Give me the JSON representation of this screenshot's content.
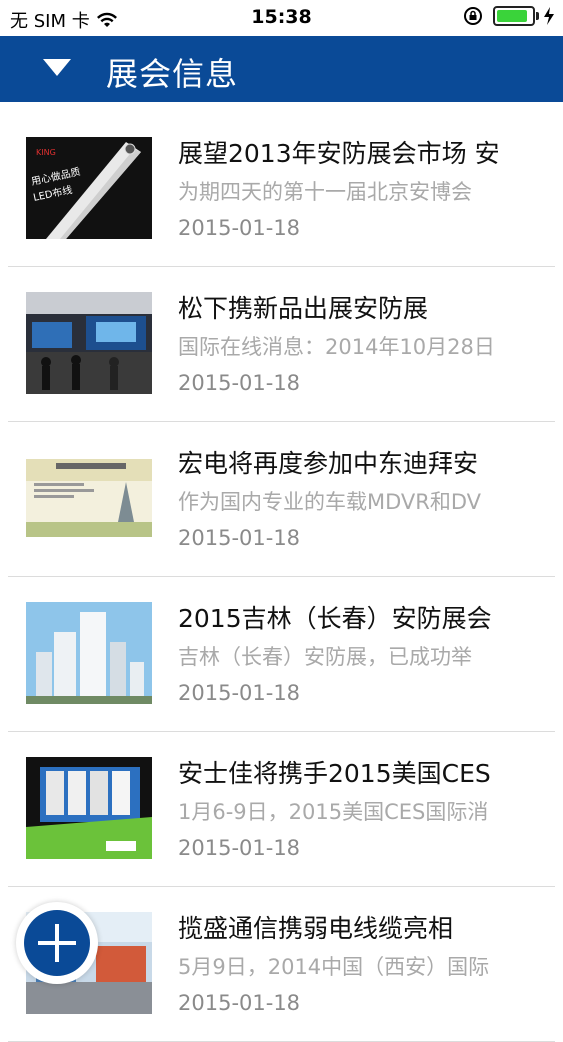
{
  "status_bar": {
    "carrier": "无 SIM 卡",
    "time": "15:38",
    "battery_level": 1.0
  },
  "navbar": {
    "title": "展会信息",
    "menu_icon": "triangle-down-icon",
    "color": "#0a4a97"
  },
  "news": [
    {
      "title": "展望2013年安防展会市场 安",
      "summary": "为期四天的第十一届北京安博会",
      "date": "2015-01-18",
      "thumb_text": "用心做品质 LED布线"
    },
    {
      "title": "松下携新品出展安防展",
      "summary": "国际在线消息：2014年10月28日",
      "date": "2015-01-18",
      "thumb_text": ""
    },
    {
      "title": "宏电将再度参加中东迪拜安",
      "summary": "作为国内专业的车载MDVR和DV",
      "date": "2015-01-18",
      "thumb_text": ""
    },
    {
      "title": "2015吉林（长春）安防展会",
      "summary": "吉林（长春）安防展，已成功举",
      "date": "2015-01-18",
      "thumb_text": ""
    },
    {
      "title": "安士佳将携手2015美国CES",
      "summary": "1月6-9日，2015美国CES国际消",
      "date": "2015-01-18",
      "thumb_text": ""
    },
    {
      "title": "揽盛通信携弱电线缆亮相",
      "summary": "5月9日，2014中国（西安）国际",
      "date": "2015-01-18",
      "thumb_text": ""
    }
  ],
  "fab": {
    "icon": "plus-icon"
  }
}
